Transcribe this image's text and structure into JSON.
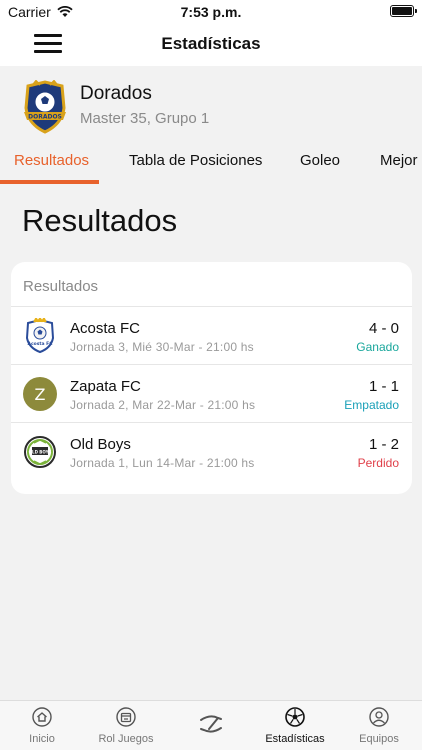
{
  "status_bar": {
    "carrier": "Carrier",
    "time": "7:53 p.m."
  },
  "nav": {
    "title": "Estadísticas"
  },
  "team": {
    "name": "Dorados",
    "subtitle": "Master 35, Grupo 1",
    "logo_text": "DORADOS"
  },
  "tabs": [
    {
      "label": "Resultados",
      "active": true
    },
    {
      "label": "Tabla de Posiciones",
      "active": false
    },
    {
      "label": "Goleo",
      "active": false
    },
    {
      "label": "Mejor",
      "active": false
    }
  ],
  "section_title": "Resultados",
  "card": {
    "header": "Resultados",
    "rows": [
      {
        "team": "Acosta FC",
        "detail": "Jornada 3, Mié 30-Mar - 21:00 hs",
        "score": "4 - 0",
        "status": "Ganado",
        "status_color": "#1aa79c",
        "logo": "acosta-fc-logo",
        "logo_text": "Acosta FC"
      },
      {
        "team": "Zapata FC",
        "detail": "Jornada 2, Mar 22-Mar - 21:00 hs",
        "score": "1 - 1",
        "status": "Empatado",
        "status_color": "#1aa0b8",
        "logo": "initial-avatar",
        "initial": "Z"
      },
      {
        "team": "Old Boys",
        "detail": "Jornada 1, Lun 14-Mar - 21:00 hs",
        "score": "1 - 2",
        "status": "Perdido",
        "status_color": "#e0404a",
        "logo": "old-boys-logo",
        "logo_text": "OLD BOYS"
      }
    ]
  },
  "tab_bar": [
    {
      "label": "Inicio",
      "icon": "home-icon"
    },
    {
      "label": "Rol Juegos",
      "icon": "calendar-icon"
    },
    {
      "label": "",
      "icon": "brand-s-icon"
    },
    {
      "label": "Estadísticas",
      "icon": "soccer-ball-icon",
      "active": true
    },
    {
      "label": "Equipos",
      "icon": "person-icon"
    }
  ],
  "colors": {
    "accent": "#e8622c",
    "zapata_avatar": "#8d8a3b"
  }
}
